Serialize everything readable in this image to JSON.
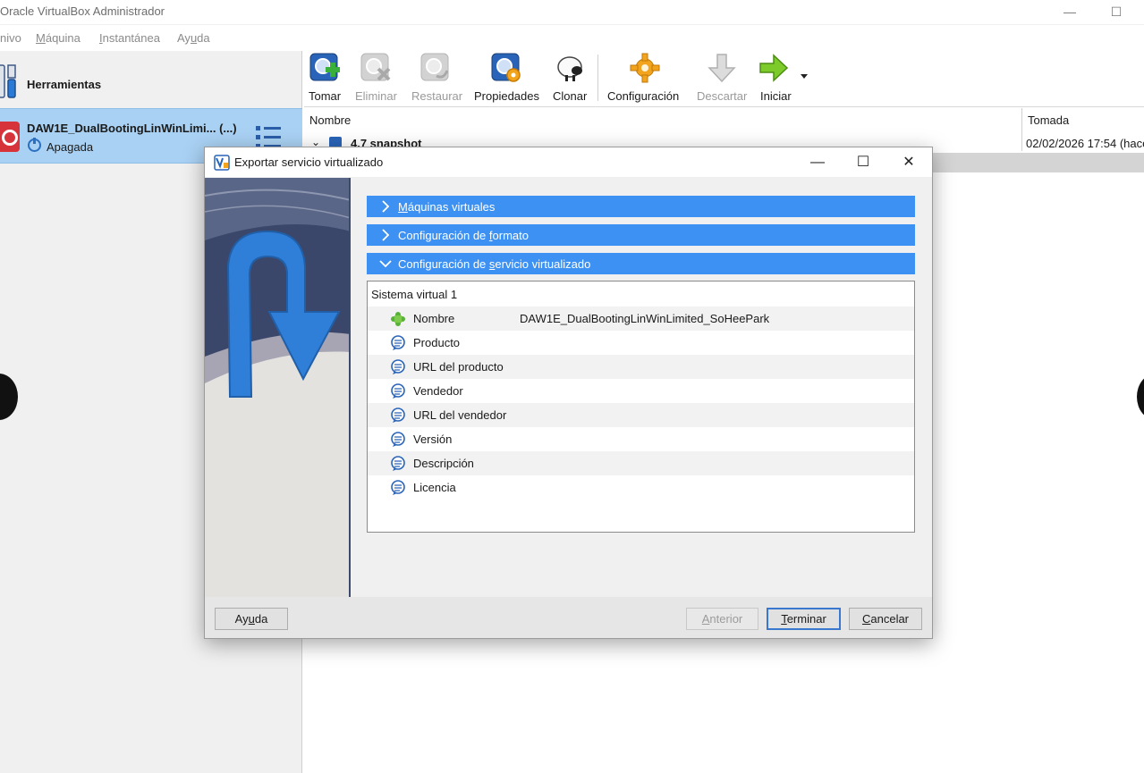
{
  "window": {
    "title": "Oracle VirtualBox Administrador",
    "minimize": "—",
    "maximize": "☐"
  },
  "menu": {
    "items": [
      {
        "pre": "",
        "u": "",
        "post": "nivo"
      },
      {
        "pre": "",
        "u": "M",
        "post": "áquina"
      },
      {
        "pre": "",
        "u": "I",
        "post": "nstantánea"
      },
      {
        "pre": "Ay",
        "u": "u",
        "post": "da"
      }
    ]
  },
  "sidebar": {
    "tools_label": "Herramientas",
    "vm_name": "DAW1E_DualBootingLinWinLimi... (...)",
    "vm_state": "Apagada"
  },
  "toolbar": {
    "take": "Tomar",
    "delete": "Eliminar",
    "restore": "Restaurar",
    "properties": "Propiedades",
    "clone": "Clonar",
    "settings": "Configuración",
    "discard": "Descartar",
    "start": "Iniciar"
  },
  "snapshots": {
    "col_name": "Nombre",
    "col_taken": "Tomada",
    "row_name": "4.7 snapshot",
    "row_taken": "02/02/2026 17:54 (hace"
  },
  "dialog": {
    "title": "Exportar servicio virtualizado",
    "sections": [
      {
        "pre": "",
        "u": "M",
        "post": "áquinas virtuales"
      },
      {
        "pre": "Configuración de ",
        "u": "f",
        "post": "ormato"
      },
      {
        "pre": "Configuración de ",
        "u": "s",
        "post": "ervicio virtualizado"
      }
    ],
    "tree_root": "Sistema virtual 1",
    "properties": [
      {
        "key": "Nombre",
        "value": "DAW1E_DualBootingLinWinLimited_SoHeePark",
        "icon": "puzzle-icon"
      },
      {
        "key": "Producto",
        "value": "",
        "icon": "speech-bubble-icon"
      },
      {
        "key": "URL del producto",
        "value": "",
        "icon": "speech-bubble-icon"
      },
      {
        "key": "Vendedor",
        "value": "",
        "icon": "speech-bubble-icon"
      },
      {
        "key": "URL del vendedor",
        "value": "",
        "icon": "speech-bubble-icon"
      },
      {
        "key": "Versión",
        "value": "",
        "icon": "speech-bubble-icon"
      },
      {
        "key": "Descripción",
        "value": "",
        "icon": "speech-bubble-icon"
      },
      {
        "key": "Licencia",
        "value": "",
        "icon": "speech-bubble-icon"
      }
    ],
    "buttons": {
      "help": {
        "pre": "Ay",
        "u": "u",
        "post": "da"
      },
      "back": {
        "pre": "",
        "u": "A",
        "post": "nterior"
      },
      "finish": {
        "pre": "",
        "u": "T",
        "post": "erminar"
      },
      "cancel": {
        "pre": "",
        "u": "C",
        "post": "ancelar"
      }
    }
  },
  "colors": {
    "accent": "#3d91f3",
    "selection": "#a9d1f3"
  }
}
